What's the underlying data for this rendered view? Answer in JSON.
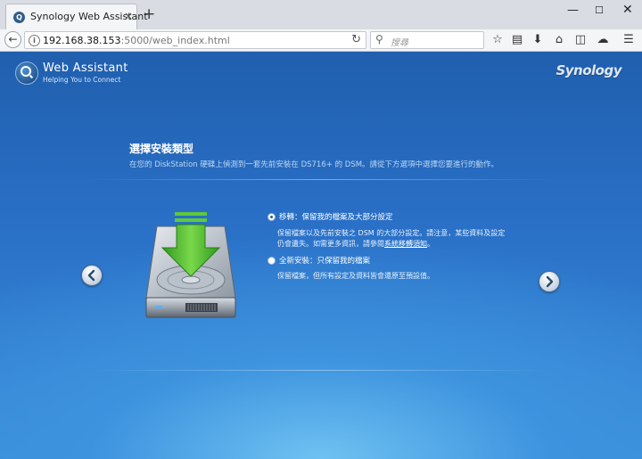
{
  "browser": {
    "tab_title": "Synology Web Assistant",
    "tab_close": "×",
    "new_tab": "+",
    "url_host": "192.168.38.153",
    "url_path": ":5000/web_index.html",
    "search_placeholder": "搜尋"
  },
  "header": {
    "app_name": "Web Assistant",
    "app_tagline": "Helping You to Connect",
    "brand": "Synology"
  },
  "content": {
    "title": "選擇安裝類型",
    "description": "在您的 DiskStation 硬碟上偵測到一套先前安裝在 DS716+ 的 DSM。請從下方選項中選擇您要進行的動作。",
    "options": [
      {
        "label": "移轉：保留我的檔案及大部分設定",
        "checked": true,
        "desc_line1": "保留檔案以及先前安裝之 DSM 的大部分設定。請注意，某些資料及設定",
        "desc_line2_prefix": "仍會遺失。如需更多資訊，請參閱",
        "desc_link": "系統移轉須知",
        "desc_line2_suffix": "。"
      },
      {
        "label": "全新安裝：只保留我的檔案",
        "checked": false,
        "desc_line1": "保留檔案，但所有設定及資料皆會還原至預設值。"
      }
    ]
  },
  "colors": {
    "page_top": "#205fae",
    "page_bottom": "#6ec2f2",
    "arrow_green": "#3fae2a"
  }
}
